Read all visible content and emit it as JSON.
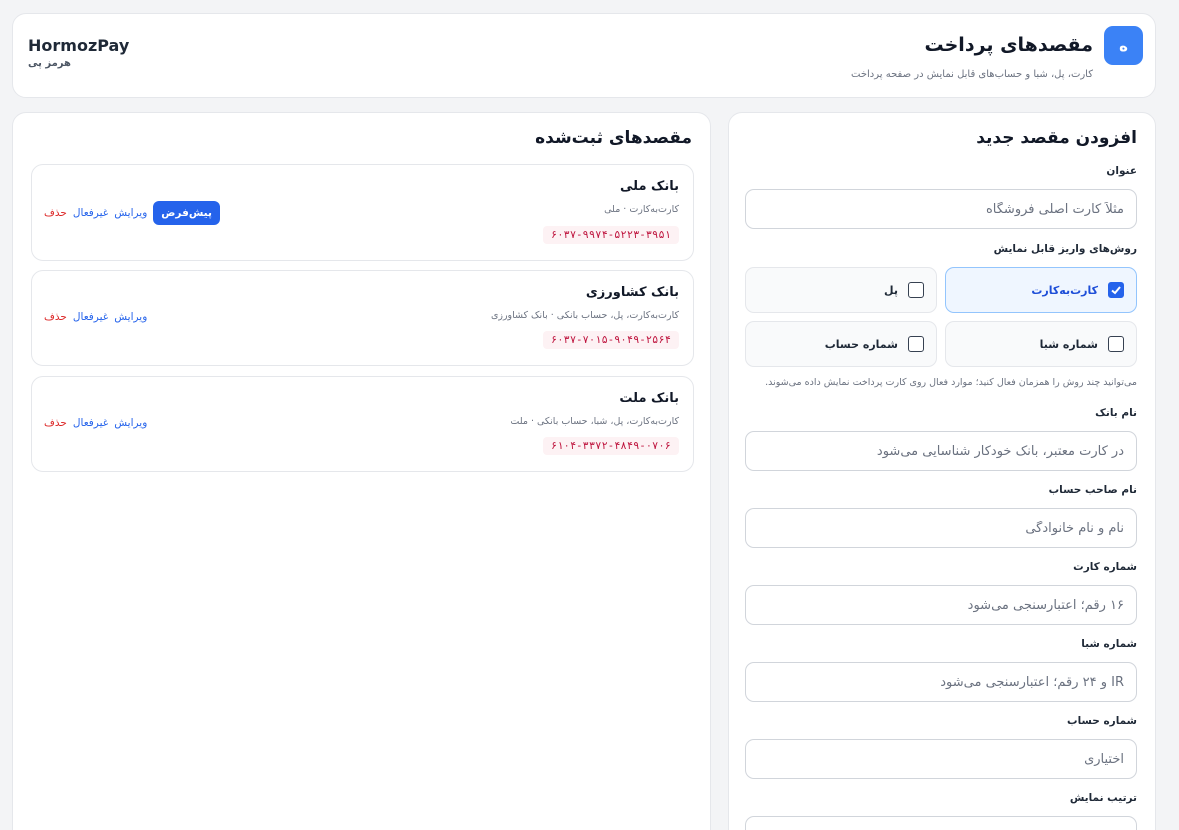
{
  "header": {
    "logo_letter": "ه",
    "title": "مقصدهای پرداخت",
    "subtitle": "کارت، پل، شبا و حساب‌های قابل نمایش در صفحه پرداخت",
    "brand_en": "HormozPay",
    "brand_fa": "هرمز پی"
  },
  "form": {
    "title": "افزودن مقصد جدید",
    "title_label": "عنوان",
    "title_placeholder": "مثلاً کارت اصلی فروشگاه",
    "methods_label": "روش‌های واریز قابل نمایش",
    "methods": [
      {
        "label": "کارت‌به‌کارت",
        "checked": true
      },
      {
        "label": "پل",
        "checked": false
      },
      {
        "label": "شماره شبا",
        "checked": false
      },
      {
        "label": "شماره حساب",
        "checked": false
      }
    ],
    "methods_hint": "می‌توانید چند روش را همزمان فعال کنید؛ موارد فعال روی کارت پرداخت نمایش داده می‌شوند.",
    "bank_label": "نام بانک",
    "bank_placeholder": "در کارت معتبر، بانک خودکار شناسایی می‌شود",
    "holder_label": "نام صاحب حساب",
    "holder_placeholder": "نام و نام خانوادگی",
    "card_label": "شماره کارت",
    "card_placeholder": "۱۶ رقم؛ اعتبارسنجی می‌شود",
    "sheba_label": "شماره شبا",
    "sheba_placeholder": "IR و ۲۴ رقم؛ اعتبارسنجی می‌شود",
    "account_label": "شماره حساب",
    "account_placeholder": "اختیاری",
    "order_label": "ترتیب نمایش"
  },
  "list": {
    "title": "مقصدهای ثبت‌شده",
    "default_label": "پیش‌فرض",
    "edit_label": "ویرایش",
    "deactivate_label": "غیرفعال",
    "delete_label": "حذف",
    "items": [
      {
        "name": "بانک ملی",
        "desc": "کارت‌به‌کارت · ملی",
        "number": "۶۰۳۷-۹۹۷۴-۵۲۲۳-۳۹۵۱",
        "is_default": true
      },
      {
        "name": "بانک کشاورزی",
        "desc": "کارت‌به‌کارت، پل، حساب بانکی · بانک کشاورزی",
        "number": "۶۰۳۷-۷۰۱۵-۹۰۴۹-۲۵۶۴",
        "is_default": false
      },
      {
        "name": "بانک ملت",
        "desc": "کارت‌به‌کارت، پل، شبا، حساب بانکی · ملت",
        "number": "۶۱۰۴-۳۳۷۲-۴۸۴۹-۰۷۰۶",
        "is_default": false
      }
    ]
  }
}
